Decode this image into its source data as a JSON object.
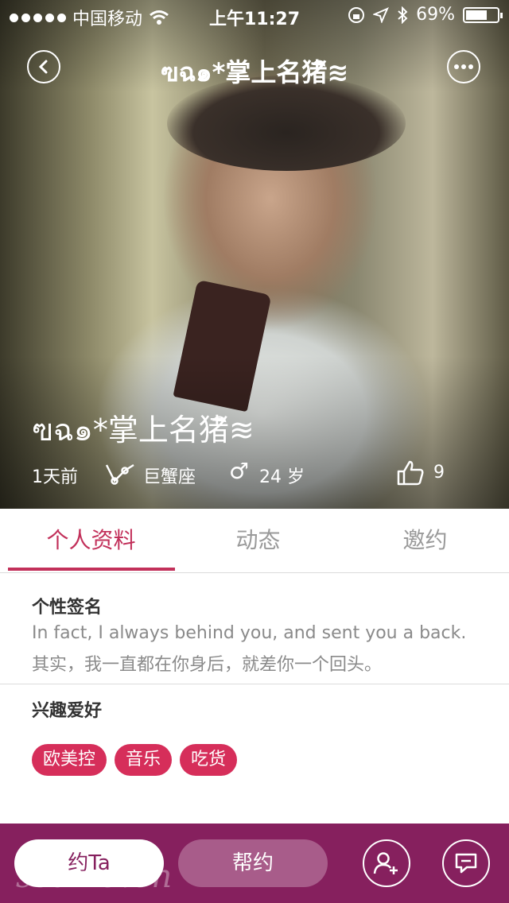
{
  "status_bar": {
    "carrier": "中国移动",
    "time": "上午11:27",
    "battery_percent": "69%",
    "battery_level": 0.69
  },
  "nav": {
    "title": "ฃฉ๑*掌上名猪ิ≋",
    "back_icon": "chevron-left-icon",
    "more_icon": "more-dots-icon"
  },
  "profile": {
    "name": "ฃฉ๑*掌上名猪ิ≋",
    "last_active": "1天前",
    "zodiac": "巨蟹座",
    "gender_symbol": "♂",
    "age": "24 岁",
    "likes": "9"
  },
  "tabs": [
    {
      "label": "个人资料",
      "active": true
    },
    {
      "label": "动态",
      "active": false
    },
    {
      "label": "邀约",
      "active": false
    }
  ],
  "signature": {
    "title": "个性签名",
    "line1": "In fact, I always behind you, and sent you a back.",
    "line2": "其实，我一直都在你身后，就差你一个回头。"
  },
  "interests": {
    "title": "兴趣爱好",
    "tags": [
      "欧美控",
      "音乐",
      "吃货"
    ]
  },
  "bottom_bar": {
    "primary_label": "约Ta",
    "secondary_label": "帮约",
    "add_friend_icon": "add-user-icon",
    "chat_icon": "chat-bubble-icon"
  },
  "watermark": "sstine.cn",
  "colors": {
    "accent": "#c2305a",
    "tag_bg": "#d62e5a",
    "bottom_bar_bg": "#86205e"
  }
}
